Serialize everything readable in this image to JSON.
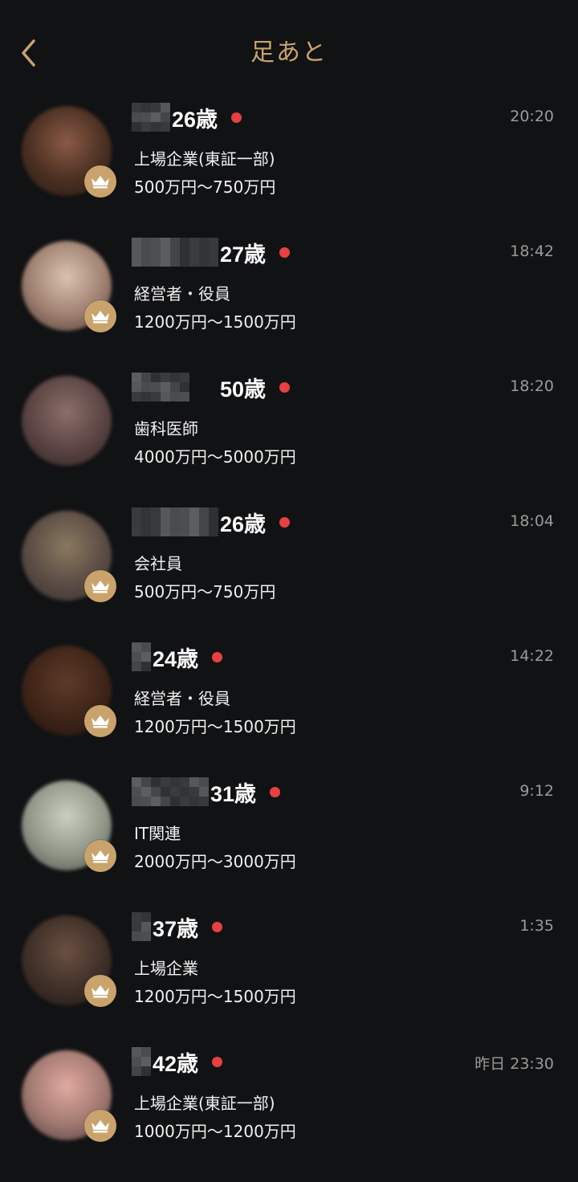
{
  "header": {
    "title": "足あと",
    "back_icon": "chevron-left-icon",
    "accent_color": "#c9a36b"
  },
  "rows": [
    {
      "name_blocks": 4,
      "age": "26歳",
      "occupation": "上場企業(東証一部)",
      "income": "500万円〜750万円",
      "time": "20:20",
      "has_crown": true,
      "online": true,
      "avatar_colors": [
        "#8a5a45",
        "#4a2f22",
        "#2a1a14"
      ]
    },
    {
      "name_blocks": 9,
      "age": "27歳",
      "occupation": "経営者・役員",
      "income": "1200万円〜1500万円",
      "time": "18:42",
      "has_crown": true,
      "online": true,
      "avatar_colors": [
        "#d9c3b0",
        "#9e7f70",
        "#4f3a36"
      ]
    },
    {
      "name_blocks": 6,
      "age": "50歳",
      "occupation": "歯科医師",
      "income": "4000万円〜5000万円",
      "time": "18:20",
      "has_crown": false,
      "online": true,
      "avatar_colors": [
        "#8a6f6a",
        "#5a4342",
        "#2d2424"
      ]
    },
    {
      "name_blocks": 9,
      "age": "26歳",
      "occupation": "会社員",
      "income": "500万円〜750万円",
      "time": "18:04",
      "has_crown": true,
      "online": true,
      "avatar_colors": [
        "#8a7860",
        "#5a4c44",
        "#34302e"
      ]
    },
    {
      "name_blocks": 2,
      "age": "24歳",
      "occupation": "経営者・役員",
      "income": "1200万円〜1500万円",
      "time": "14:22",
      "has_crown": true,
      "online": true,
      "avatar_colors": [
        "#5e3a28",
        "#3e2418",
        "#211410"
      ]
    },
    {
      "name_blocks": 8,
      "age": "31歳",
      "occupation": "IT関連",
      "income": "2000万円〜3000万円",
      "time": "9:12",
      "has_crown": true,
      "online": true,
      "avatar_colors": [
        "#c9cfc0",
        "#8f9688",
        "#4c524a"
      ]
    },
    {
      "name_blocks": 2,
      "age": "37歳",
      "occupation": "上場企業",
      "income": "1200万円〜1500万円",
      "time": "1:35",
      "has_crown": true,
      "online": true,
      "avatar_colors": [
        "#6a5040",
        "#3f2f28",
        "#201a18"
      ]
    },
    {
      "name_blocks": 2,
      "age": "42歳",
      "occupation": "上場企業(東証一部)",
      "income": "1000万円〜1200万円",
      "time": "昨日 23:30",
      "has_crown": true,
      "online": true,
      "avatar_colors": [
        "#e0a9a0",
        "#a07870",
        "#4a3a3a"
      ]
    }
  ],
  "icons": {
    "crown": "crown-icon",
    "online": "online-dot"
  },
  "colors": {
    "background": "#111214",
    "online_dot": "#e84040",
    "crown_badge": "#c9a36b",
    "time_text": "#9a9a9a"
  }
}
